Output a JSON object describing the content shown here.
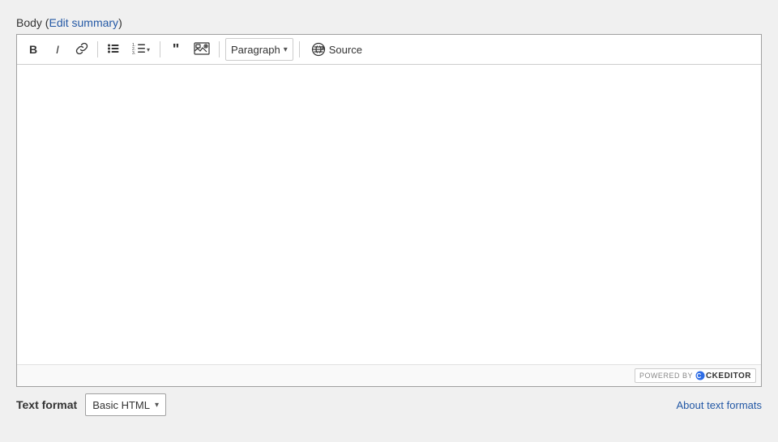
{
  "header": {
    "body_label": "Body",
    "edit_summary_label": "Edit summary"
  },
  "toolbar": {
    "bold_label": "B",
    "italic_label": "I",
    "link_tooltip": "Link",
    "bullet_list_tooltip": "Bullet List",
    "numbered_list_tooltip": "Numbered List",
    "blockquote_tooltip": "Block Quote",
    "image_tooltip": "Insert Image",
    "paragraph_label": "Paragraph",
    "paragraph_chevron": "▾",
    "source_label": "Source"
  },
  "branding": {
    "powered_by": "POWERED BY",
    "ck_logo": "CKEditor"
  },
  "footer": {
    "text_format_label": "Text format",
    "format_value": "Basic HTML",
    "format_chevron": "▾",
    "about_link": "About text formats"
  }
}
